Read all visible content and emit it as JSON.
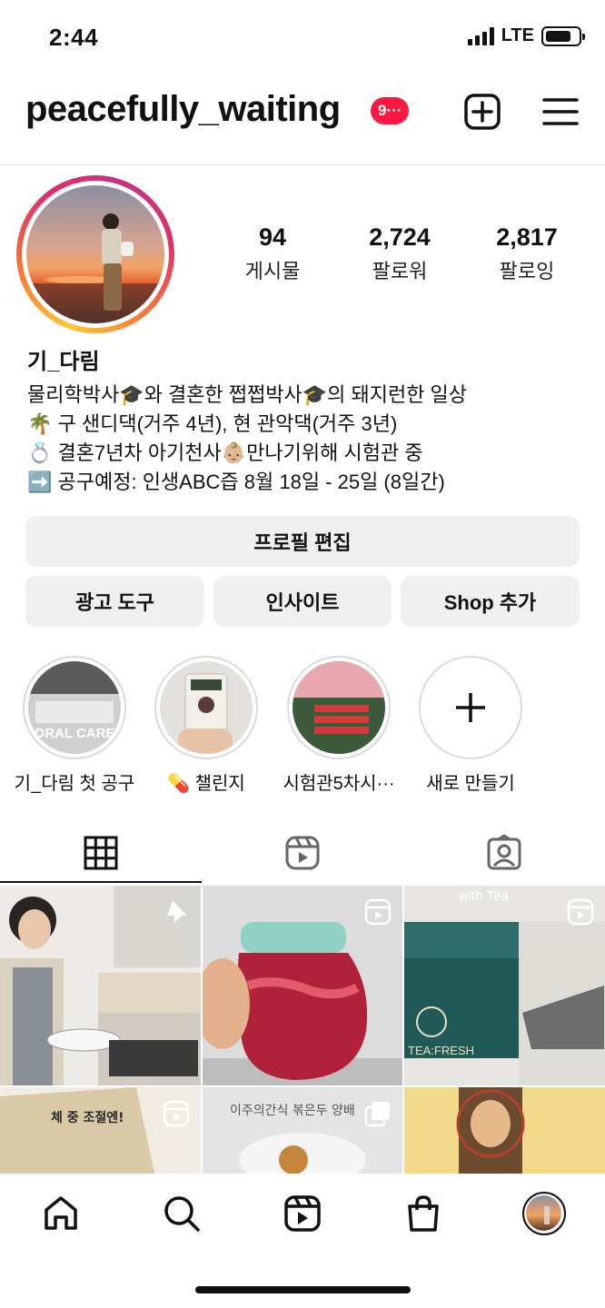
{
  "status": {
    "time": "2:44",
    "network": "LTE"
  },
  "header": {
    "username": "peacefully_waiting",
    "notif_count": "9···"
  },
  "profile": {
    "stats": [
      {
        "num": "94",
        "label": "게시물"
      },
      {
        "num": "2,724",
        "label": "팔로워"
      },
      {
        "num": "2,817",
        "label": "팔로잉"
      }
    ],
    "name": "기_다림",
    "bio": [
      "물리학박사🎓와 결혼한 쩝쩝박사🎓의 돼지런한 일상",
      "🌴 구 샌디댁(거주 4년), 현 관악댁(거주 3년)",
      "💍 결혼7년차 아기천사👶🏼만나기위해 시험관 중",
      "➡️ 공구예정: 인생ABC즙 8월 18일 - 25일 (8일간)"
    ]
  },
  "buttons": {
    "edit": "프로필 편집",
    "ad": "광고 도구",
    "insight": "인사이트",
    "shop": "Shop 추가"
  },
  "highlights": [
    {
      "label": "기_다림 첫 공구",
      "cover_text": "ORAL CARE"
    },
    {
      "label": "💊 챌린지"
    },
    {
      "label": "시험관5차시···"
    },
    {
      "label": "새로 만들기"
    }
  ],
  "grid": {
    "cell_texts": [
      "with Tea",
      "TEA:FRESH",
      "체 중 조절엔!",
      "이주의간식 볶은두 양배"
    ]
  }
}
